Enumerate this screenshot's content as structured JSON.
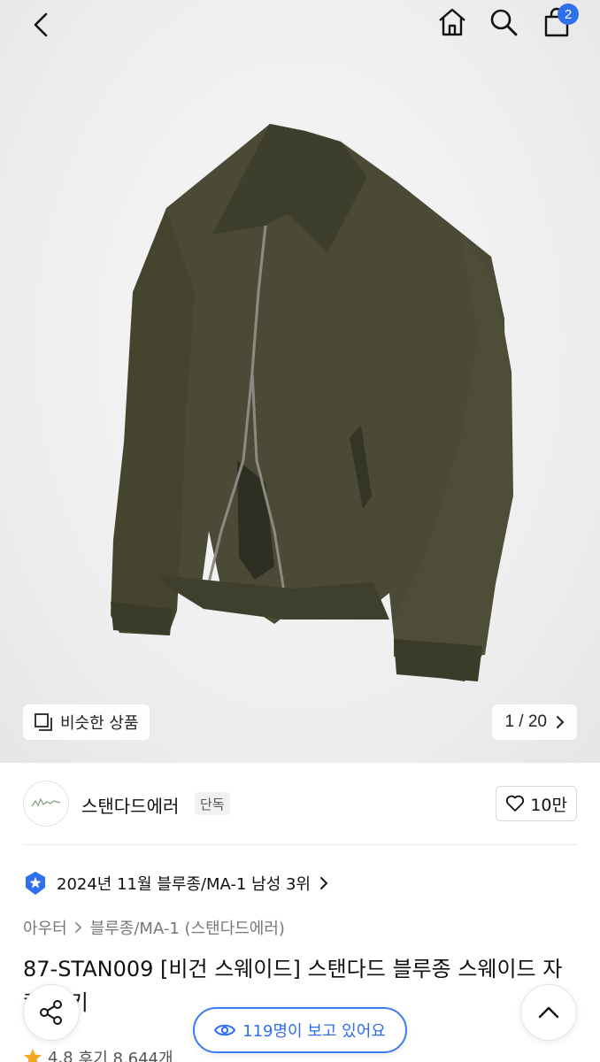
{
  "header": {
    "cart_count": "2"
  },
  "gallery": {
    "similar_label": "비슷한 상품",
    "counter": "1 / 20"
  },
  "brand": {
    "name": "스탠다드에러",
    "exclusive_badge": "단독",
    "likes": "10만"
  },
  "ranking": {
    "text": "2024년 11월 블루종/MA-1 남성 3위"
  },
  "breadcrumb": {
    "level1": "아우터",
    "level2": "블루종/MA-1 (스탠다드에러)"
  },
  "product": {
    "title": "87-STAN009 [비건 스웨이드] 스탠다드 블루종 스웨이드 자켓 카키",
    "rating": "4.8",
    "reviews": "후기 8,644개"
  },
  "floating": {
    "viewers": "119명이 보고 있어요"
  },
  "colors": {
    "accent": "#2f6fed",
    "jacket": "#4a4a36",
    "star": "#f5a623"
  }
}
